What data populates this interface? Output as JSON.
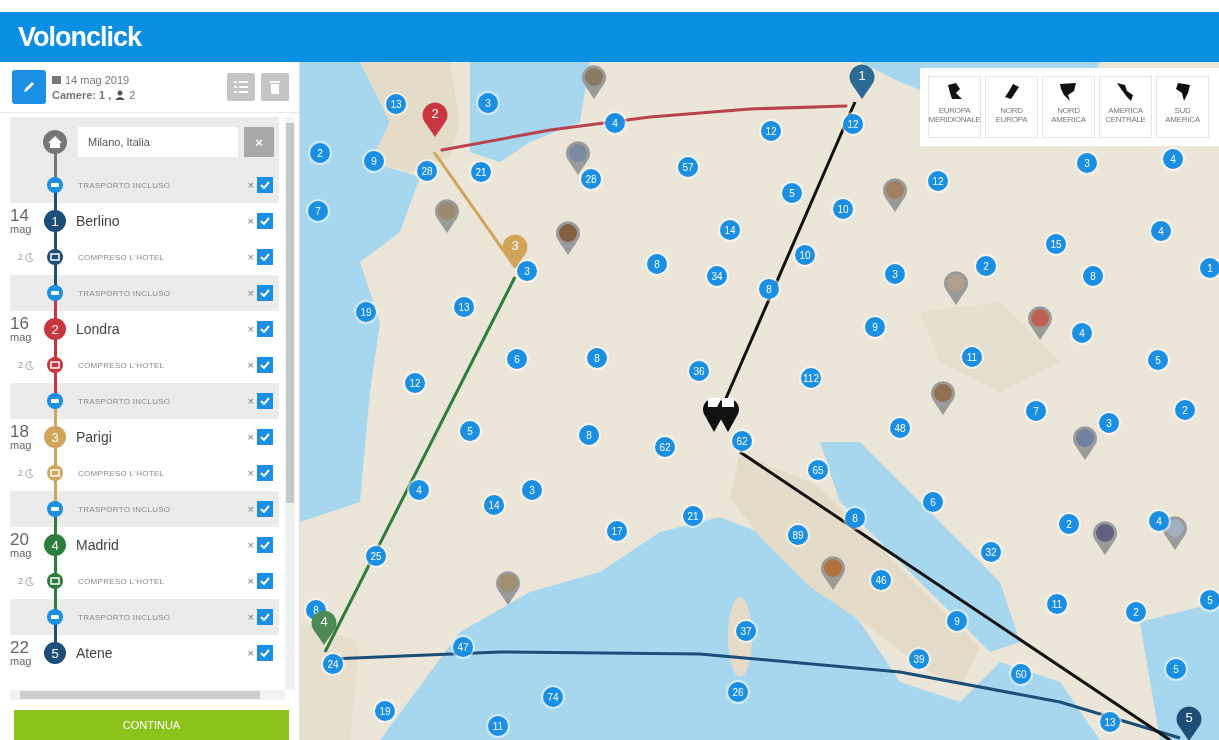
{
  "header": {
    "logo": "Volonclick"
  },
  "trip": {
    "date": "14 mag 2019",
    "rooms": "Camere: 1 ,",
    "guests": "2"
  },
  "start": {
    "value": "Milano, Italia",
    "clear": "×"
  },
  "itinerary": [
    {
      "kind": "transport",
      "label": "TRASPORTO INCLUSO",
      "remove": "×",
      "checked": true
    },
    {
      "kind": "city",
      "day": "14",
      "month": "mag",
      "number": "1",
      "name": "Berlino",
      "color": "#1d4e77",
      "remove": "×",
      "checked": true,
      "nights": "2",
      "hotel": {
        "label": "COMPRESO L'HOTEL",
        "remove": "×",
        "checked": true
      }
    },
    {
      "kind": "transport",
      "label": "TRASPORTO INCLUSO",
      "remove": "×",
      "checked": true
    },
    {
      "kind": "city",
      "day": "16",
      "month": "mag",
      "number": "2",
      "name": "Londra",
      "color": "#c8363f",
      "remove": "×",
      "checked": true,
      "nights": "2",
      "hotel": {
        "label": "COMPRESO L'HOTEL",
        "remove": "×",
        "checked": true
      }
    },
    {
      "kind": "transport",
      "label": "TRASPORTO INCLUSO",
      "remove": "×",
      "checked": true
    },
    {
      "kind": "city",
      "day": "18",
      "month": "mag",
      "number": "3",
      "name": "Parigi",
      "color": "#d0a55a",
      "remove": "×",
      "checked": true,
      "nights": "2",
      "hotel": {
        "label": "COMPRESO L'HOTEL",
        "remove": "×",
        "checked": true
      }
    },
    {
      "kind": "transport",
      "label": "TRASPORTO INCLUSO",
      "remove": "×",
      "checked": true
    },
    {
      "kind": "city",
      "day": "20",
      "month": "mag",
      "number": "4",
      "name": "Madrid",
      "color": "#2e7d3c",
      "remove": "×",
      "checked": true,
      "nights": "2",
      "hotel": {
        "label": "COMPRESO L'HOTEL",
        "remove": "×",
        "checked": true
      }
    },
    {
      "kind": "transport",
      "label": "TRASPORTO INCLUSO",
      "remove": "×",
      "checked": true
    },
    {
      "kind": "city",
      "day": "22",
      "month": "mag",
      "number": "5",
      "name": "Atene",
      "color": "#1d4e77",
      "remove": "×",
      "checked": true
    }
  ],
  "continue_button": "CONTINUA",
  "regions": [
    {
      "label": "EUROPA MERIDIONALE"
    },
    {
      "label": "NORD EUROPA"
    },
    {
      "label": "NORD AMERICA"
    },
    {
      "label": "AMERICA CENTRALE"
    },
    {
      "label": "SUD AMERICA"
    }
  ],
  "map": {
    "kind": "picture",
    "route_pins": [
      {
        "number": "1",
        "color": "#2a6a94"
      },
      {
        "number": "2",
        "color": "#c8363f"
      },
      {
        "number": "3",
        "color": "#d0a55a"
      },
      {
        "number": "4",
        "color": "#4f8a55"
      },
      {
        "number": "5",
        "color": "#1d4e77"
      }
    ],
    "clusters": [
      "13",
      "3",
      "4",
      "12",
      "12",
      "2",
      "9",
      "28",
      "21",
      "28",
      "57",
      "12",
      "3",
      "4",
      "5",
      "7",
      "10",
      "14",
      "4",
      "15",
      "3",
      "8",
      "34",
      "10",
      "3",
      "2",
      "8",
      "1",
      "8",
      "19",
      "13",
      "9",
      "4",
      "6",
      "8",
      "11",
      "5",
      "12",
      "36",
      "112",
      "7",
      "2",
      "5",
      "8",
      "62",
      "62",
      "48",
      "3",
      "65",
      "4",
      "3",
      "14",
      "6",
      "17",
      "21",
      "89",
      "8",
      "2",
      "4",
      "25",
      "32",
      "46",
      "8",
      "37",
      "9",
      "11",
      "2",
      "5",
      "47",
      "24",
      "39",
      "60",
      "5",
      "74",
      "26",
      "19",
      "11",
      "13"
    ]
  }
}
